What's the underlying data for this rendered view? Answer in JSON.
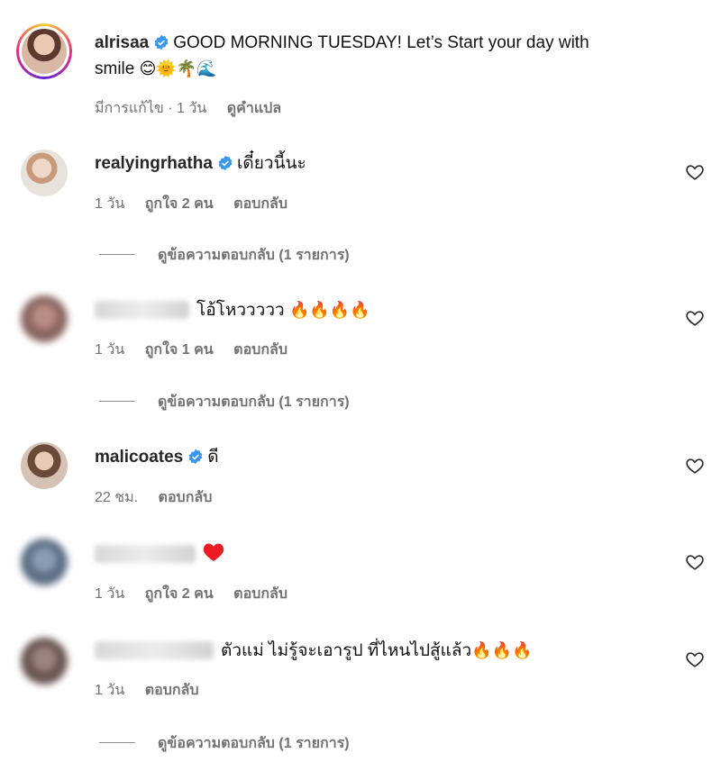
{
  "caption": {
    "username": "alrisaa",
    "text": "GOOD MORNING TUESDAY! Let’s Start your day with",
    "text2": "smile",
    "emojis": "😊🌞🌴🌊",
    "edited": "มีการแก้ไข · 1 วัน",
    "translate": "ดูคำแปล"
  },
  "comments": [
    {
      "username": "realyingrhatha",
      "verified": true,
      "text": "เดี๋ยวนี้นะ",
      "time": "1 วัน",
      "likes": "ถูกใจ 2 คน",
      "reply": "ตอบกลับ",
      "view_replies": "ดูข้อความตอบกลับ (1 รายการ)"
    },
    {
      "username": "",
      "verified": false,
      "text": "โอ้โหววววว",
      "emojis": "🔥🔥🔥🔥",
      "time": "1 วัน",
      "likes": "ถูกใจ 1 คน",
      "reply": "ตอบกลับ",
      "view_replies": "ดูข้อความตอบกลับ (1 รายการ)"
    },
    {
      "username": "malicoates",
      "verified": true,
      "text": "ดี",
      "time": "22 ชม.",
      "reply": "ตอบกลับ"
    },
    {
      "username": "",
      "verified": false,
      "emojis": "❤",
      "time": "1 วัน",
      "likes": "ถูกใจ 2 คน",
      "reply": "ตอบกลับ"
    },
    {
      "username": "",
      "verified": false,
      "text": "ตัวแม่ ไม่รู้จะเอารูป ที่ไหนไปสู้แล้ว",
      "emojis": "🔥🔥🔥",
      "time": "1 วัน",
      "reply": "ตอบกลับ",
      "view_replies": "ดูข้อความตอบกลับ (1 รายการ)"
    }
  ],
  "colors": {
    "verified": "#3897f0",
    "meta": "#737373",
    "heart_red": "#ed1c24"
  }
}
